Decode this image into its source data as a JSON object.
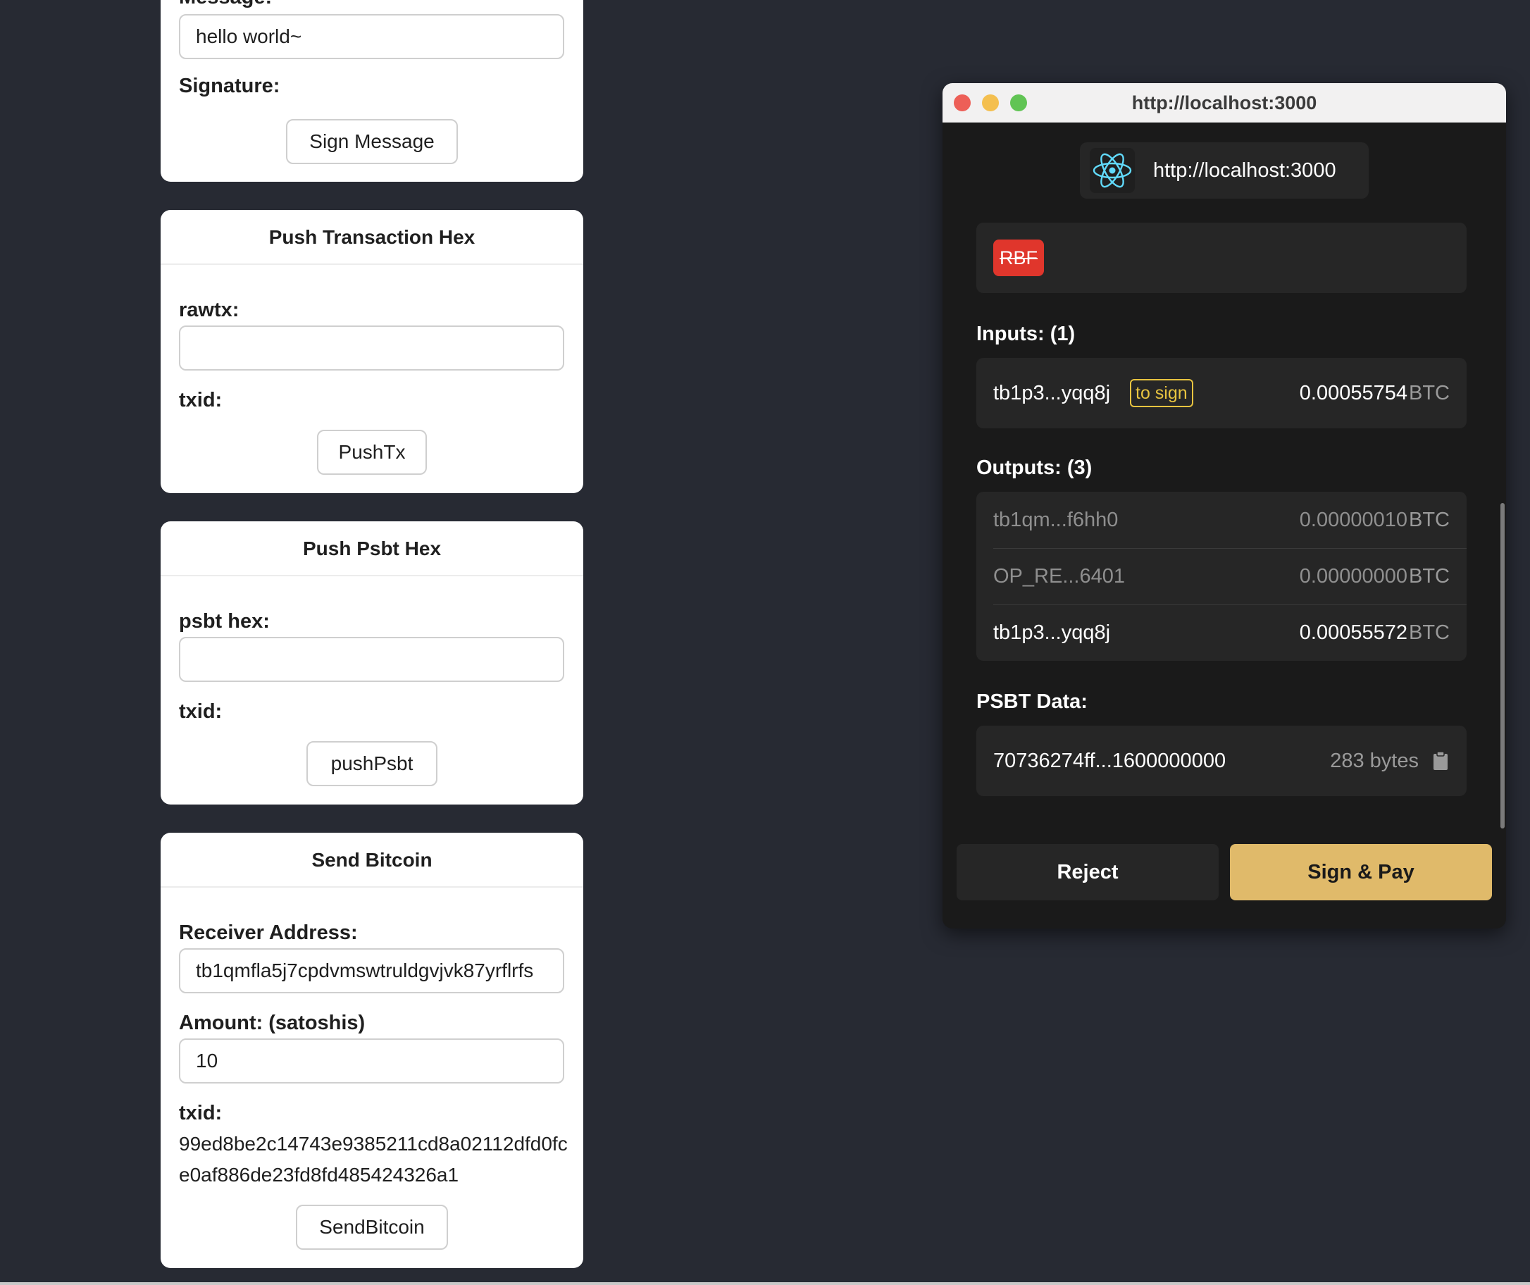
{
  "sign_message_card": {
    "message_label": "Message:",
    "message_value": "hello world~",
    "signature_label": "Signature:",
    "button_label": "Sign Message"
  },
  "push_tx_card": {
    "title": "Push Transaction Hex",
    "rawtx_label": "rawtx:",
    "rawtx_value": "",
    "txid_label": "txid:",
    "button_label": "PushTx"
  },
  "push_psbt_card": {
    "title": "Push Psbt Hex",
    "psbt_label": "psbt hex:",
    "psbt_value": "",
    "txid_label": "txid:",
    "button_label": "pushPsbt"
  },
  "send_bitcoin_card": {
    "title": "Send Bitcoin",
    "receiver_label": "Receiver Address:",
    "receiver_value": "tb1qmfla5j7cpdvmswtruldgvjvk87yrflrfs",
    "amount_label": "Amount: (satoshis)",
    "amount_value": "10",
    "txid_label": "txid:",
    "txid_value": "99ed8be2c14743e9385211cd8a02112dfd0fce0af886de23fd8fd485424326a1",
    "button_label": "SendBitcoin"
  },
  "popup": {
    "window_title": "http://localhost:3000",
    "origin": "http://localhost:3000",
    "origin_icon": "react-icon",
    "rbf_badge": "RBF",
    "inputs_title": "Inputs: (1)",
    "inputs": [
      {
        "address": "tb1p3...yqq8j",
        "tag": "to sign",
        "amount": "0.00055754",
        "unit": "BTC"
      }
    ],
    "outputs_title": "Outputs: (3)",
    "outputs": [
      {
        "address": "tb1qm...f6hh0",
        "amount": "0.00000010",
        "unit": "BTC",
        "dimmed": true
      },
      {
        "address": "OP_RE...6401",
        "amount": "0.00000000",
        "unit": "BTC",
        "dimmed": true
      },
      {
        "address": "tb1p3...yqq8j",
        "amount": "0.00055572",
        "unit": "BTC",
        "dimmed": false
      }
    ],
    "psbt_title": "PSBT Data:",
    "psbt_hex": "70736274ff...1600000000",
    "psbt_size": "283 bytes",
    "copy_icon": "clipboard-icon",
    "reject_label": "Reject",
    "sign_label": "Sign & Pay"
  },
  "colors": {
    "page_bg": "#272a33",
    "popup_bg": "#1a1a1a",
    "panel_bg": "#262626",
    "rbf_red": "#e0362c",
    "tag_yellow": "#e8c440",
    "sign_button": "#e0ba6a",
    "react_blue": "#61dafb"
  }
}
